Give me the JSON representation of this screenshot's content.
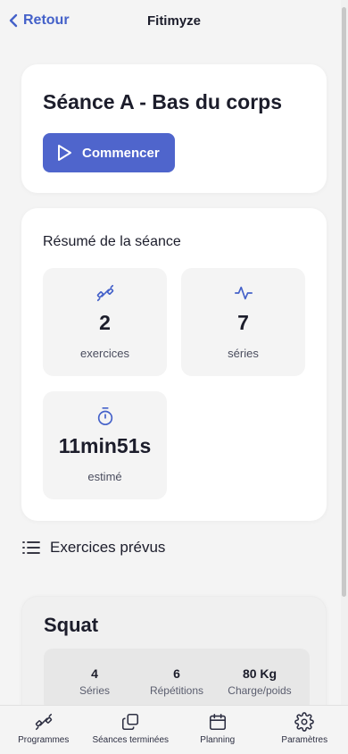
{
  "header": {
    "back_label": "Retour",
    "title": "Fitimyze"
  },
  "session": {
    "title": "Séance A - Bas du corps",
    "start_label": "Commencer"
  },
  "summary": {
    "title": "Résumé de la séance",
    "stats": [
      {
        "value": "2",
        "label": "exercices",
        "icon": "dumbbell-icon"
      },
      {
        "value": "7",
        "label": "séries",
        "icon": "activity-icon"
      },
      {
        "value": "11min51s",
        "label": "estimé",
        "icon": "timer-icon"
      }
    ]
  },
  "exercises": {
    "heading": "Exercices prévus",
    "items": [
      {
        "name": "Squat",
        "sets": {
          "value": "4",
          "label": "Séries"
        },
        "reps": {
          "value": "6",
          "label": "Répétitions"
        },
        "load": {
          "value": "80 Kg",
          "label": "Charge/poids"
        }
      }
    ]
  },
  "nav": [
    {
      "label": "Programmes",
      "icon": "dumbbell-icon"
    },
    {
      "label": "Séances terminées",
      "icon": "copy-icon"
    },
    {
      "label": "Planning",
      "icon": "calendar-icon"
    },
    {
      "label": "Paramètres",
      "icon": "gear-icon"
    }
  ],
  "colors": {
    "accent": "#4f65cc",
    "link": "#4461c9",
    "background": "#f4f4f4",
    "card": "#ffffff"
  }
}
